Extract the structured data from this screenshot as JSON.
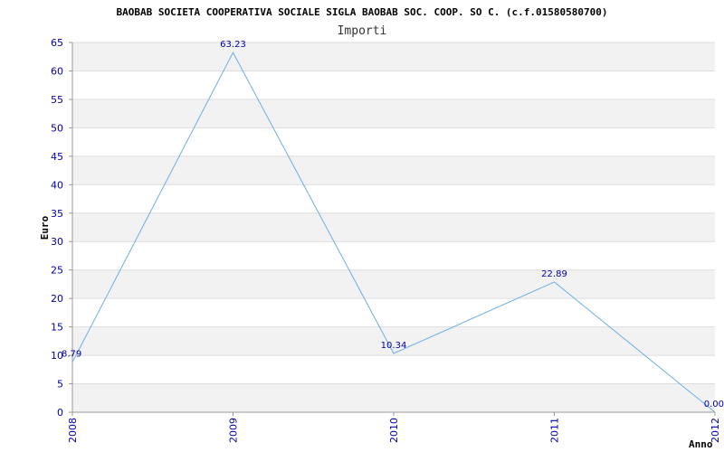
{
  "chart_data": {
    "type": "line",
    "title": "BAOBAB SOCIETA COOPERATIVA SOCIALE SIGLA BAOBAB SOC. COOP. SO C. (c.f.01580580700)",
    "subtitle": "Importi",
    "xlabel": "Anno",
    "ylabel": "Euro",
    "categories": [
      "2008",
      "2009",
      "2010",
      "2011",
      "2012"
    ],
    "series": [
      {
        "values": [
          8.79,
          63.23,
          10.34,
          22.89,
          0.0
        ]
      }
    ],
    "data_labels": [
      "8.79",
      "63.23",
      "10.34",
      "22.89",
      "0.00"
    ],
    "ylim": [
      0,
      65
    ],
    "yticks": [
      0,
      5,
      10,
      15,
      20,
      25,
      30,
      35,
      40,
      45,
      50,
      55,
      60,
      65
    ],
    "grid": true,
    "colors": {
      "line": "#6aaee8",
      "band": "#f2f2f2",
      "grid": "#dddddd",
      "axis": "#999999",
      "tick_text": "#0000aa"
    }
  }
}
